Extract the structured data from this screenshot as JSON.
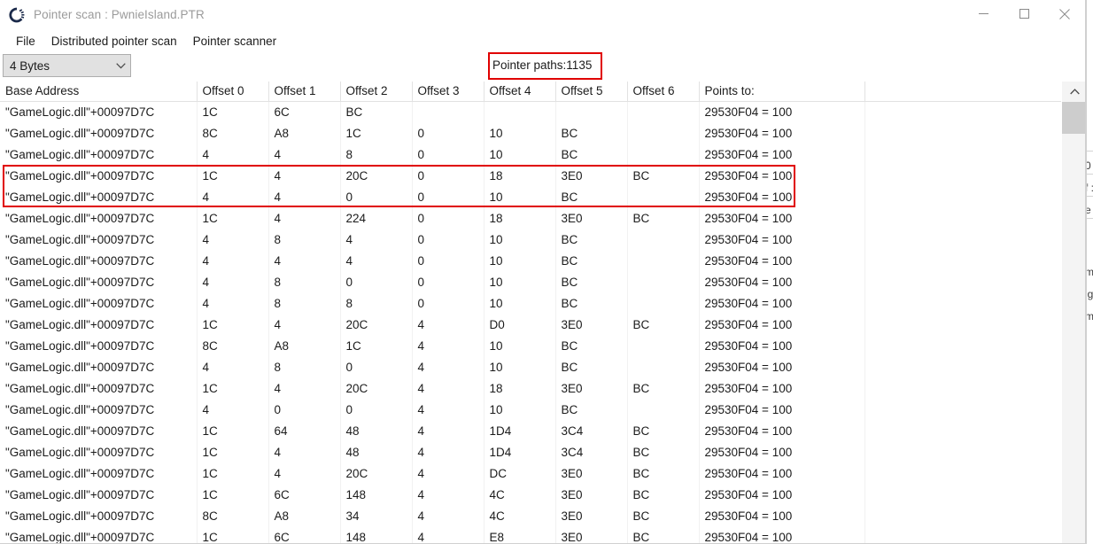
{
  "window": {
    "title": "Pointer scan : PwnieIsland.PTR",
    "icon": "cheat-engine-logo-icon",
    "controls": {
      "minimize": "minimize-icon",
      "maximize": "maximize-icon",
      "close": "close-icon"
    }
  },
  "menu": {
    "items": [
      {
        "label": "File"
      },
      {
        "label": "Distributed pointer scan"
      },
      {
        "label": "Pointer scanner"
      }
    ]
  },
  "toolbar": {
    "value_type": {
      "selected": "4 Bytes",
      "arrow_icon": "chevron-down-icon"
    },
    "pointer_paths_label": "Pointer paths:1135"
  },
  "colors": {
    "highlight_red": "#e00000",
    "text": "#1b1b1b",
    "title_text": "#9b9b9b",
    "combo_bg": "#e1e1e1",
    "grid_line": "#e2e2e2",
    "scrollbar_thumb": "#cdcdcd"
  },
  "table": {
    "columns": [
      "Base Address",
      "Offset 0",
      "Offset 1",
      "Offset 2",
      "Offset 3",
      "Offset 4",
      "Offset 5",
      "Offset 6",
      "Points to:"
    ],
    "rows": [
      {
        "base": "\"GameLogic.dll\"+00097D7C",
        "offsets": [
          "1C",
          "6C",
          "BC",
          "",
          "",
          "",
          ""
        ],
        "points_to": "29530F04 = 100"
      },
      {
        "base": "\"GameLogic.dll\"+00097D7C",
        "offsets": [
          "8C",
          "A8",
          "1C",
          "0",
          "10",
          "BC",
          ""
        ],
        "points_to": "29530F04 = 100"
      },
      {
        "base": "\"GameLogic.dll\"+00097D7C",
        "offsets": [
          "4",
          "4",
          "8",
          "0",
          "10",
          "BC",
          ""
        ],
        "points_to": "29530F04 = 100"
      },
      {
        "base": "\"GameLogic.dll\"+00097D7C",
        "offsets": [
          "1C",
          "4",
          "20C",
          "0",
          "18",
          "3E0",
          "BC"
        ],
        "points_to": "29530F04 = 100"
      },
      {
        "base": "\"GameLogic.dll\"+00097D7C",
        "offsets": [
          "4",
          "4",
          "0",
          "0",
          "10",
          "BC",
          ""
        ],
        "points_to": "29530F04 = 100"
      },
      {
        "base": "\"GameLogic.dll\"+00097D7C",
        "offsets": [
          "1C",
          "4",
          "224",
          "0",
          "18",
          "3E0",
          "BC"
        ],
        "points_to": "29530F04 = 100"
      },
      {
        "base": "\"GameLogic.dll\"+00097D7C",
        "offsets": [
          "4",
          "8",
          "4",
          "0",
          "10",
          "BC",
          ""
        ],
        "points_to": "29530F04 = 100"
      },
      {
        "base": "\"GameLogic.dll\"+00097D7C",
        "offsets": [
          "4",
          "4",
          "4",
          "0",
          "10",
          "BC",
          ""
        ],
        "points_to": "29530F04 = 100"
      },
      {
        "base": "\"GameLogic.dll\"+00097D7C",
        "offsets": [
          "4",
          "8",
          "0",
          "0",
          "10",
          "BC",
          ""
        ],
        "points_to": "29530F04 = 100"
      },
      {
        "base": "\"GameLogic.dll\"+00097D7C",
        "offsets": [
          "4",
          "8",
          "8",
          "0",
          "10",
          "BC",
          ""
        ],
        "points_to": "29530F04 = 100"
      },
      {
        "base": "\"GameLogic.dll\"+00097D7C",
        "offsets": [
          "1C",
          "4",
          "20C",
          "4",
          "D0",
          "3E0",
          "BC"
        ],
        "points_to": "29530F04 = 100"
      },
      {
        "base": "\"GameLogic.dll\"+00097D7C",
        "offsets": [
          "8C",
          "A8",
          "1C",
          "4",
          "10",
          "BC",
          ""
        ],
        "points_to": "29530F04 = 100"
      },
      {
        "base": "\"GameLogic.dll\"+00097D7C",
        "offsets": [
          "4",
          "8",
          "0",
          "4",
          "10",
          "BC",
          ""
        ],
        "points_to": "29530F04 = 100"
      },
      {
        "base": "\"GameLogic.dll\"+00097D7C",
        "offsets": [
          "1C",
          "4",
          "20C",
          "4",
          "18",
          "3E0",
          "BC"
        ],
        "points_to": "29530F04 = 100"
      },
      {
        "base": "\"GameLogic.dll\"+00097D7C",
        "offsets": [
          "4",
          "0",
          "0",
          "4",
          "10",
          "BC",
          ""
        ],
        "points_to": "29530F04 = 100"
      },
      {
        "base": "\"GameLogic.dll\"+00097D7C",
        "offsets": [
          "1C",
          "64",
          "48",
          "4",
          "1D4",
          "3C4",
          "BC"
        ],
        "points_to": "29530F04 = 100"
      },
      {
        "base": "\"GameLogic.dll\"+00097D7C",
        "offsets": [
          "1C",
          "4",
          "48",
          "4",
          "1D4",
          "3C4",
          "BC"
        ],
        "points_to": "29530F04 = 100"
      },
      {
        "base": "\"GameLogic.dll\"+00097D7C",
        "offsets": [
          "1C",
          "4",
          "20C",
          "4",
          "DC",
          "3E0",
          "BC"
        ],
        "points_to": "29530F04 = 100"
      },
      {
        "base": "\"GameLogic.dll\"+00097D7C",
        "offsets": [
          "1C",
          "6C",
          "148",
          "4",
          "4C",
          "3E0",
          "BC"
        ],
        "points_to": "29530F04 = 100"
      },
      {
        "base": "\"GameLogic.dll\"+00097D7C",
        "offsets": [
          "8C",
          "A8",
          "34",
          "4",
          "4C",
          "3E0",
          "BC"
        ],
        "points_to": "29530F04 = 100"
      },
      {
        "base": "\"GameLogic.dll\"+00097D7C",
        "offsets": [
          "1C",
          "6C",
          "148",
          "4",
          "E8",
          "3E0",
          "BC"
        ],
        "points_to": "29530F04 = 100"
      }
    ]
  },
  "scrollbar": {
    "up_arrow_icon": "chevron-up-icon"
  },
  "background_window": {
    "fragments": [
      "0",
      "f :",
      "e",
      "m",
      "ig",
      "m"
    ]
  }
}
